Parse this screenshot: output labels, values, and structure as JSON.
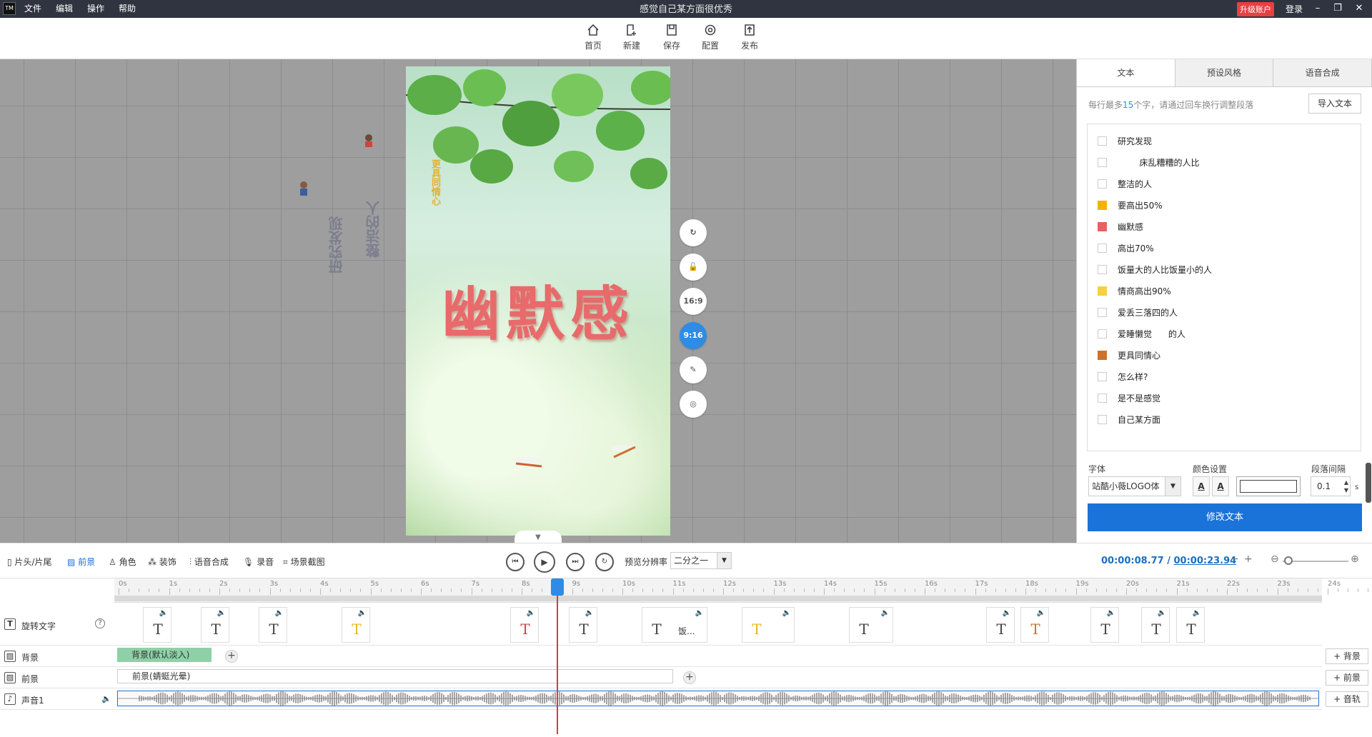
{
  "app": {
    "logo": "TM",
    "menu": [
      "文件",
      "编辑",
      "操作",
      "帮助"
    ],
    "window_title": "感觉自己某方面很优秀",
    "upgrade": "升级账户",
    "login": "登录"
  },
  "toolbar": {
    "home": "首页",
    "new": "新建",
    "save": "保存",
    "config": "配置",
    "publish": "发布"
  },
  "stage": {
    "main_text": "幽默感",
    "small_vertical": "更具同情心",
    "ghost_text_1": "研究发现",
    "ghost_text_2": "整洁的人",
    "tools": [
      "16:9",
      "9:16"
    ]
  },
  "right_panel": {
    "tabs": [
      "文本",
      "预设风格",
      "语音合成"
    ],
    "hint_prefix": "每行最多",
    "hint_count": "15",
    "hint_suffix": "个字，请通过回车换行调整段落",
    "import_button": "导入文本",
    "text_items": [
      {
        "label": "研究发现",
        "color": ""
      },
      {
        "label": "        床乱糟糟的人比",
        "color": ""
      },
      {
        "label": "整洁的人",
        "color": ""
      },
      {
        "label": "要高出50%",
        "color": "#f0b400"
      },
      {
        "label": "幽默感",
        "color": "#e86060"
      },
      {
        "label": "高出70%",
        "color": ""
      },
      {
        "label": "饭量大的人比饭量小的人",
        "color": ""
      },
      {
        "label": "情商高出90%",
        "color": "#f5d040"
      },
      {
        "label": "爱丢三落四的人",
        "color": ""
      },
      {
        "label": "爱睡懒觉      的人",
        "color": ""
      },
      {
        "label": "更具同情心",
        "color": "#d0702a"
      },
      {
        "label": "怎么样?",
        "color": ""
      },
      {
        "label": "是不是感觉",
        "color": ""
      },
      {
        "label": "自己某方面",
        "color": ""
      }
    ],
    "font_label": "字体",
    "font_value": "站酷小薇LOGO体",
    "color_label": "颜色设置",
    "spacing_label": "段落间隔",
    "spacing_value": "0.1",
    "spacing_unit": "s",
    "modify_button": "修改文本"
  },
  "timeline_bar": {
    "tabs": [
      "片头/片尾",
      "前景",
      "角色",
      "装饰",
      "语音合成",
      "录音",
      "场景截图"
    ],
    "active_tab": "前景",
    "preview_res_label": "预览分辨率",
    "preview_res_value": "二分之一",
    "current_time": "00:00:08.77",
    "separator": "/",
    "total_time": "00:00:23.94"
  },
  "timeline": {
    "ruler_labels": [
      "0s",
      "1s",
      "2s",
      "3s",
      "4s",
      "5s",
      "6s",
      "7s",
      "8s",
      "9s",
      "10s",
      "11s",
      "12s",
      "13s",
      "14s",
      "15s",
      "16s",
      "17s",
      "18s",
      "19s",
      "20s",
      "21s",
      "22s",
      "23s",
      "24s"
    ],
    "tracks": {
      "text": "旋转文字",
      "background": "背景",
      "foreground": "前景",
      "audio": "声音1"
    },
    "bg_clip": "背景(默认淡入)",
    "fg_clip": "前景(蜻蜓光晕)",
    "text_clip_sub": "饭...",
    "add_bg": "+ 背景",
    "add_fg": "+ 前景",
    "add_audio": "+ 音轨"
  }
}
